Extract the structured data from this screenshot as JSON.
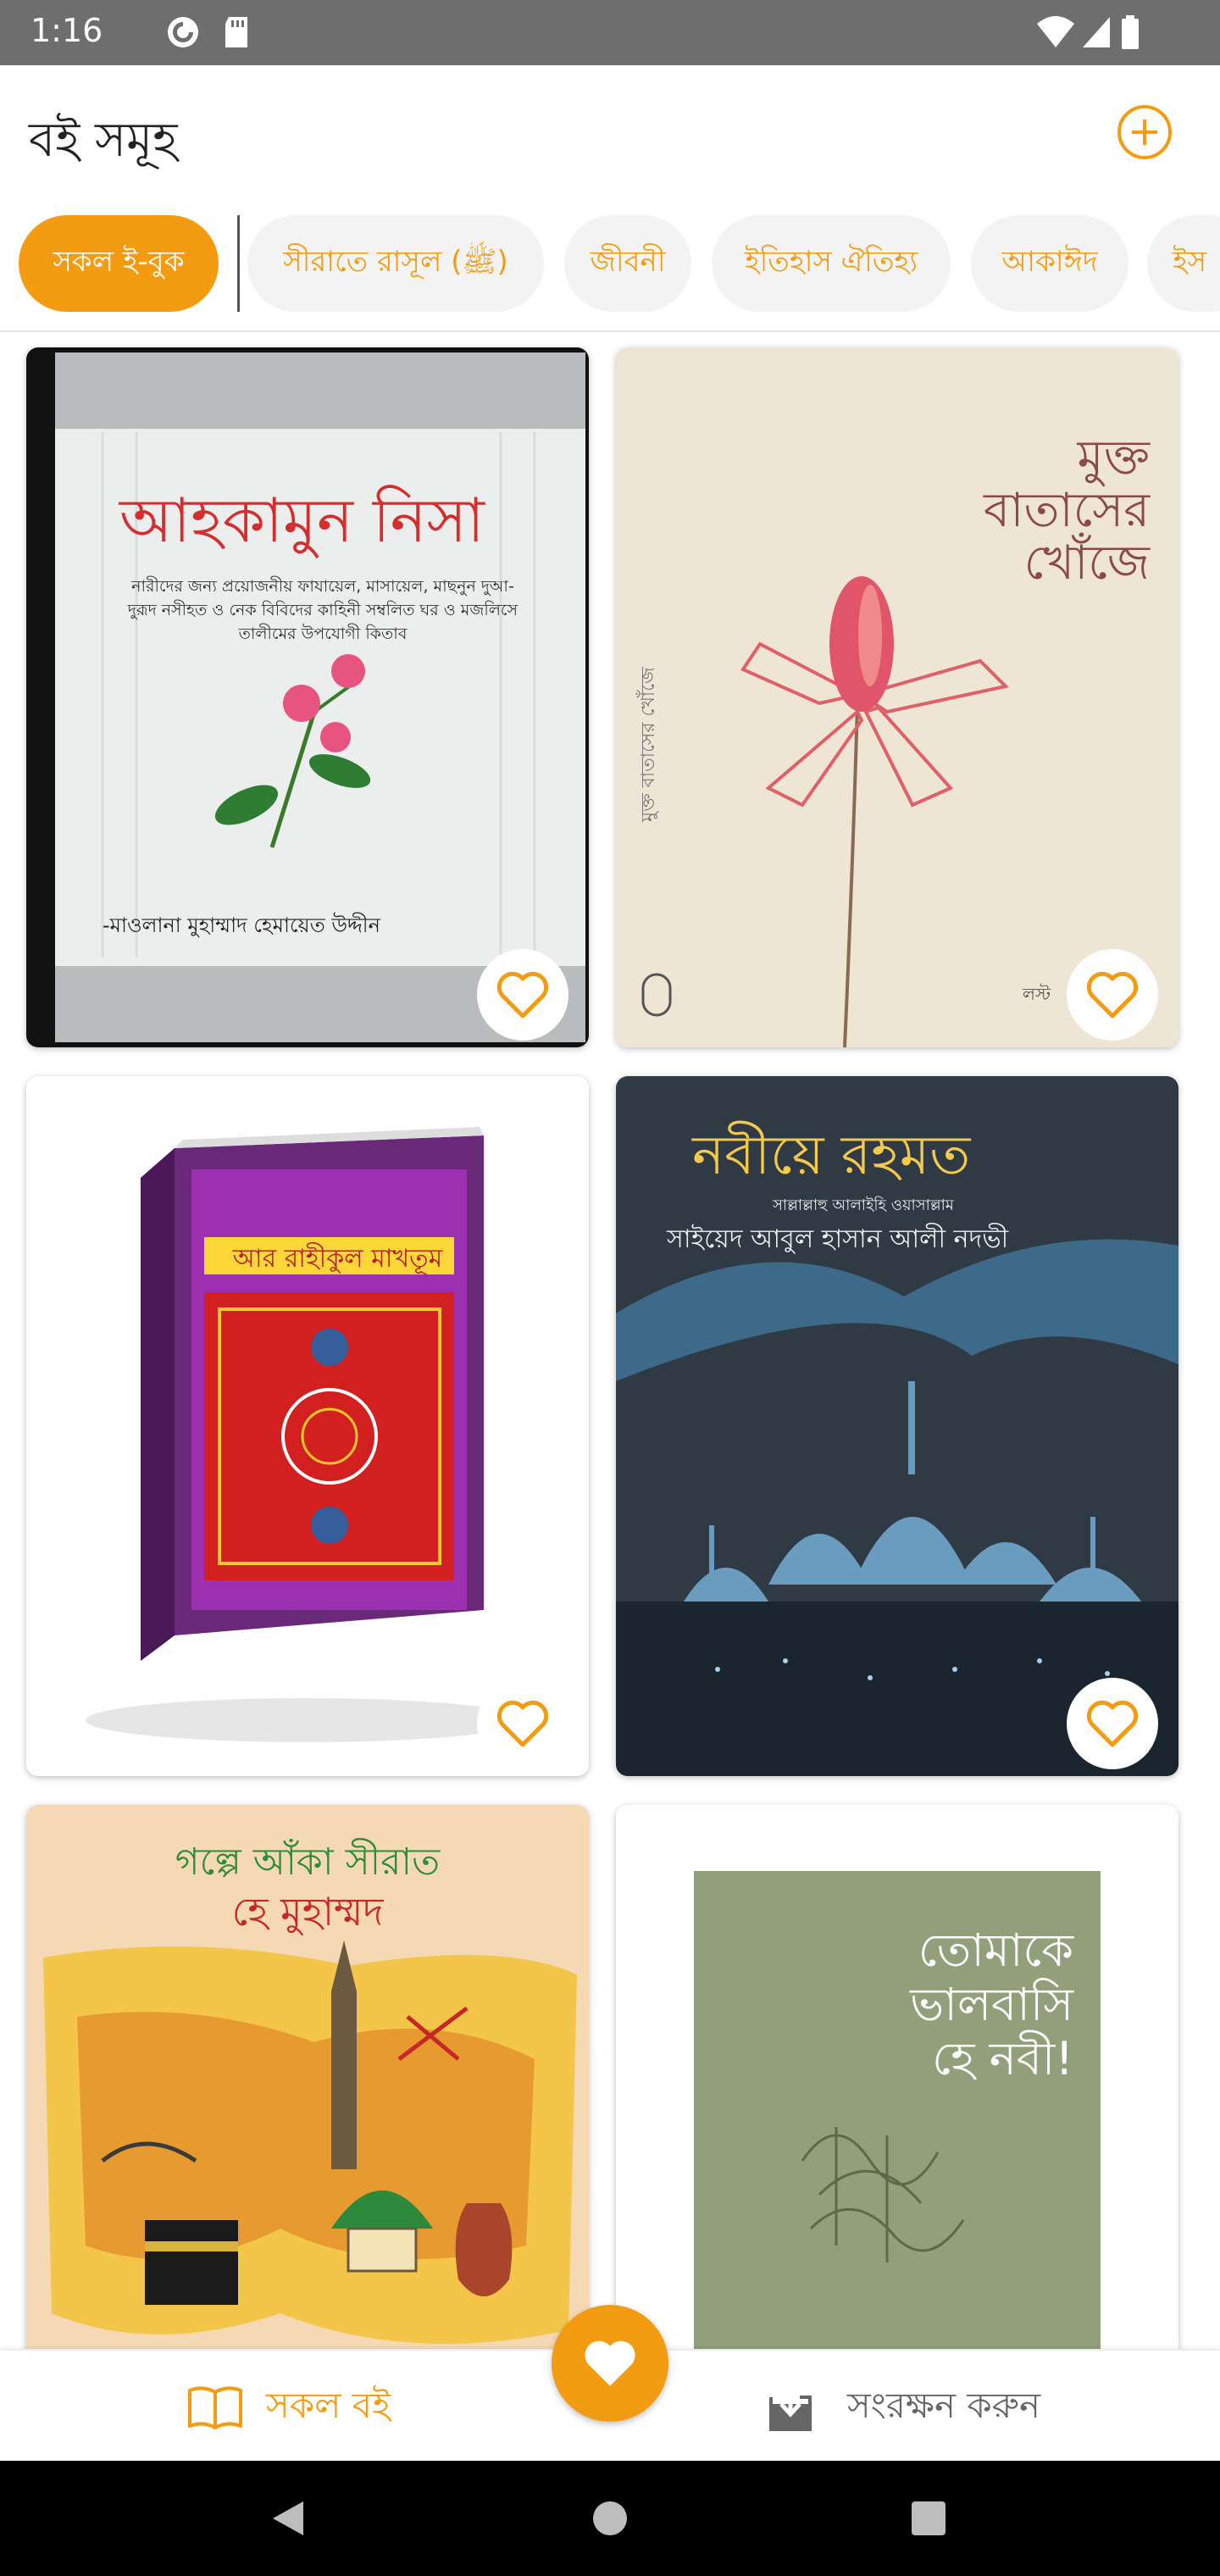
{
  "status_bar": {
    "time": "1:16",
    "icons": [
      "pocket-casts-icon",
      "sd-card-icon",
      "wifi-icon",
      "signal-icon",
      "battery-icon"
    ]
  },
  "header": {
    "title": "বই সমূহ",
    "add_icon": "plus-circle-icon"
  },
  "categories": [
    {
      "label": "সকল ই-বুক",
      "active": true
    },
    {
      "label": "সীরাতে রাসূল (ﷺ)",
      "active": false
    },
    {
      "label": "জীবনী",
      "active": false
    },
    {
      "label": "ইতিহাস ঐতিহ্য",
      "active": false
    },
    {
      "label": "আকাঈদ",
      "active": false
    },
    {
      "label": "ইস",
      "active": false
    }
  ],
  "books": [
    {
      "title": "আহকামুন নিসা",
      "subtitle": "নারীদের জন্য প্রয়োজনীয় ফাযায়েল, মাসায়েল, মাছনুন দুআ-দুরূদ নসীহত ও নেক বিবিদের কাহিনী সম্বলিত ঘর ও মজলিসে তালীমের উপযোগী কিতাব",
      "author": "-মাওলানা মুহাম্মাদ হেমায়েত উদ্দীন",
      "favorite_icon": "heart-outline-icon"
    },
    {
      "title_lines": [
        "মুক্ত",
        "বাতাসের",
        "খোঁজে"
      ],
      "spine": "মুক্ত বাতাসের খোঁজে",
      "corner": "লস্ট",
      "favorite_icon": "heart-outline-icon"
    },
    {
      "title": "আর রাহীকুল মাখতূম",
      "favorite_icon": "heart-outline-icon"
    },
    {
      "title": "নবীয়ে রহমত",
      "subtitle": "সাল্লাল্লাহু আলাইহি ওয়াসাল্লাম",
      "author": "সাইয়েদ আবুল হাসান আলী নদভী",
      "favorite_icon": "heart-outline-icon"
    },
    {
      "title_line1": "গল্পে আঁকা সীরাত",
      "title_line2": "হে মুহাম্মদ"
    },
    {
      "title_lines": [
        "তোমাকে",
        "ভালবাসি",
        "হে নবী!"
      ]
    }
  ],
  "bottom_nav": {
    "all_books": {
      "label": "সকল বই",
      "icon": "book-open-icon"
    },
    "save": {
      "label": "সংরক্ষন করুন",
      "icon": "download-icon"
    },
    "fab_icon": "heart-filled-icon"
  },
  "colors": {
    "accent": "#f39c12",
    "status_bar": "#6e6e6e",
    "chip_bg": "#f3f3f3"
  }
}
